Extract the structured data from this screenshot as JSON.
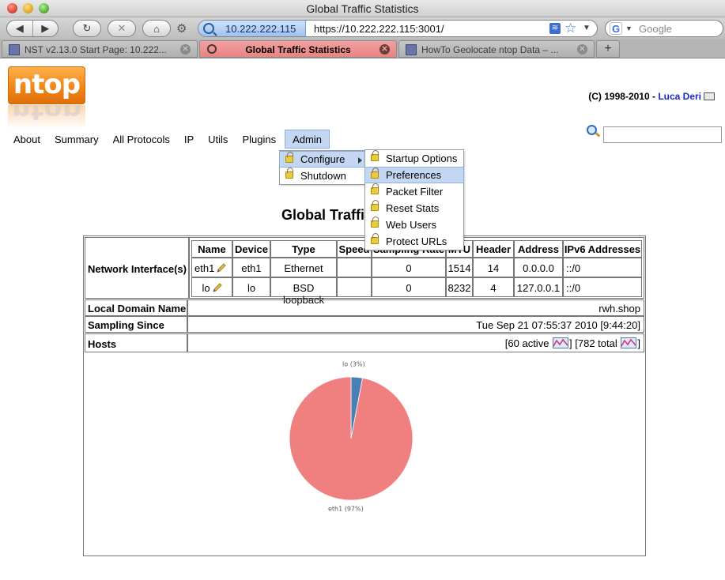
{
  "window": {
    "title": "Global Traffic Statistics"
  },
  "toolbar": {
    "back": "◀",
    "forward": "▶",
    "reload": "↻",
    "stop": "✕",
    "home": "⌂",
    "site_identity": "10.222.222.115",
    "url": "https://10.222.222.115:3001/",
    "search_placeholder": "Google"
  },
  "tabs": [
    {
      "label": "NST v2.13.0 Start Page: 10.222..."
    },
    {
      "label": "Global Traffic Statistics"
    },
    {
      "label": "HowTo Geolocate ntop Data – ..."
    }
  ],
  "new_tab_label": "+",
  "logo": {
    "text": "ntop"
  },
  "copyright": {
    "prefix": "(C) 1998-2010 - ",
    "author": "Luca Deri"
  },
  "menu": {
    "items": [
      "About",
      "Summary",
      "All Protocols",
      "IP",
      "Utils",
      "Plugins",
      "Admin"
    ]
  },
  "admin_menu": [
    "Configure",
    "Shutdown"
  ],
  "configure_menu": [
    "Startup Options",
    "Preferences",
    "Packet Filter",
    "Reset Stats",
    "Web Users",
    "Protect URLs"
  ],
  "page_title": "Global Traffic Statistics",
  "table": {
    "network_interfaces_label": "Network Interface(s)",
    "headers": [
      "Name",
      "Device",
      "Type",
      "Speed",
      "Sampling Rate",
      "MTU",
      "Header",
      "Address",
      "IPv6 Addresses"
    ],
    "rows": [
      {
        "name": "eth1",
        "device": "eth1",
        "type": "Ethernet",
        "speed": "",
        "sampling": "0",
        "mtu": "1514",
        "header": "14",
        "address": "0.0.0.0",
        "ipv6": "::/0"
      },
      {
        "name": "lo",
        "device": "lo",
        "type": "BSD loopback",
        "speed": "",
        "sampling": "0",
        "mtu": "8232",
        "header": "4",
        "address": "127.0.0.1",
        "ipv6": "::/0"
      }
    ],
    "local_domain_label": "Local Domain Name",
    "local_domain_value": "rwh.shop",
    "sampling_since_label": "Sampling Since",
    "sampling_since_value": "Tue Sep 21 07:55:37 2010 [9:44:20]",
    "hosts_label": "Hosts",
    "hosts_active": "[60 active ",
    "hosts_total": "] [782 total ",
    "hosts_end": "]"
  },
  "chart_data": {
    "type": "pie",
    "slices": [
      {
        "label": "eth1 (97%)",
        "value": 97,
        "color": "#f08080"
      },
      {
        "label": "lo (3%)",
        "value": 3,
        "color": "#4a7fb5"
      }
    ]
  },
  "colors": {
    "menu_highlight": "#c3d7f2",
    "active_tab": "#ef9393",
    "link": "#1a2aca"
  }
}
